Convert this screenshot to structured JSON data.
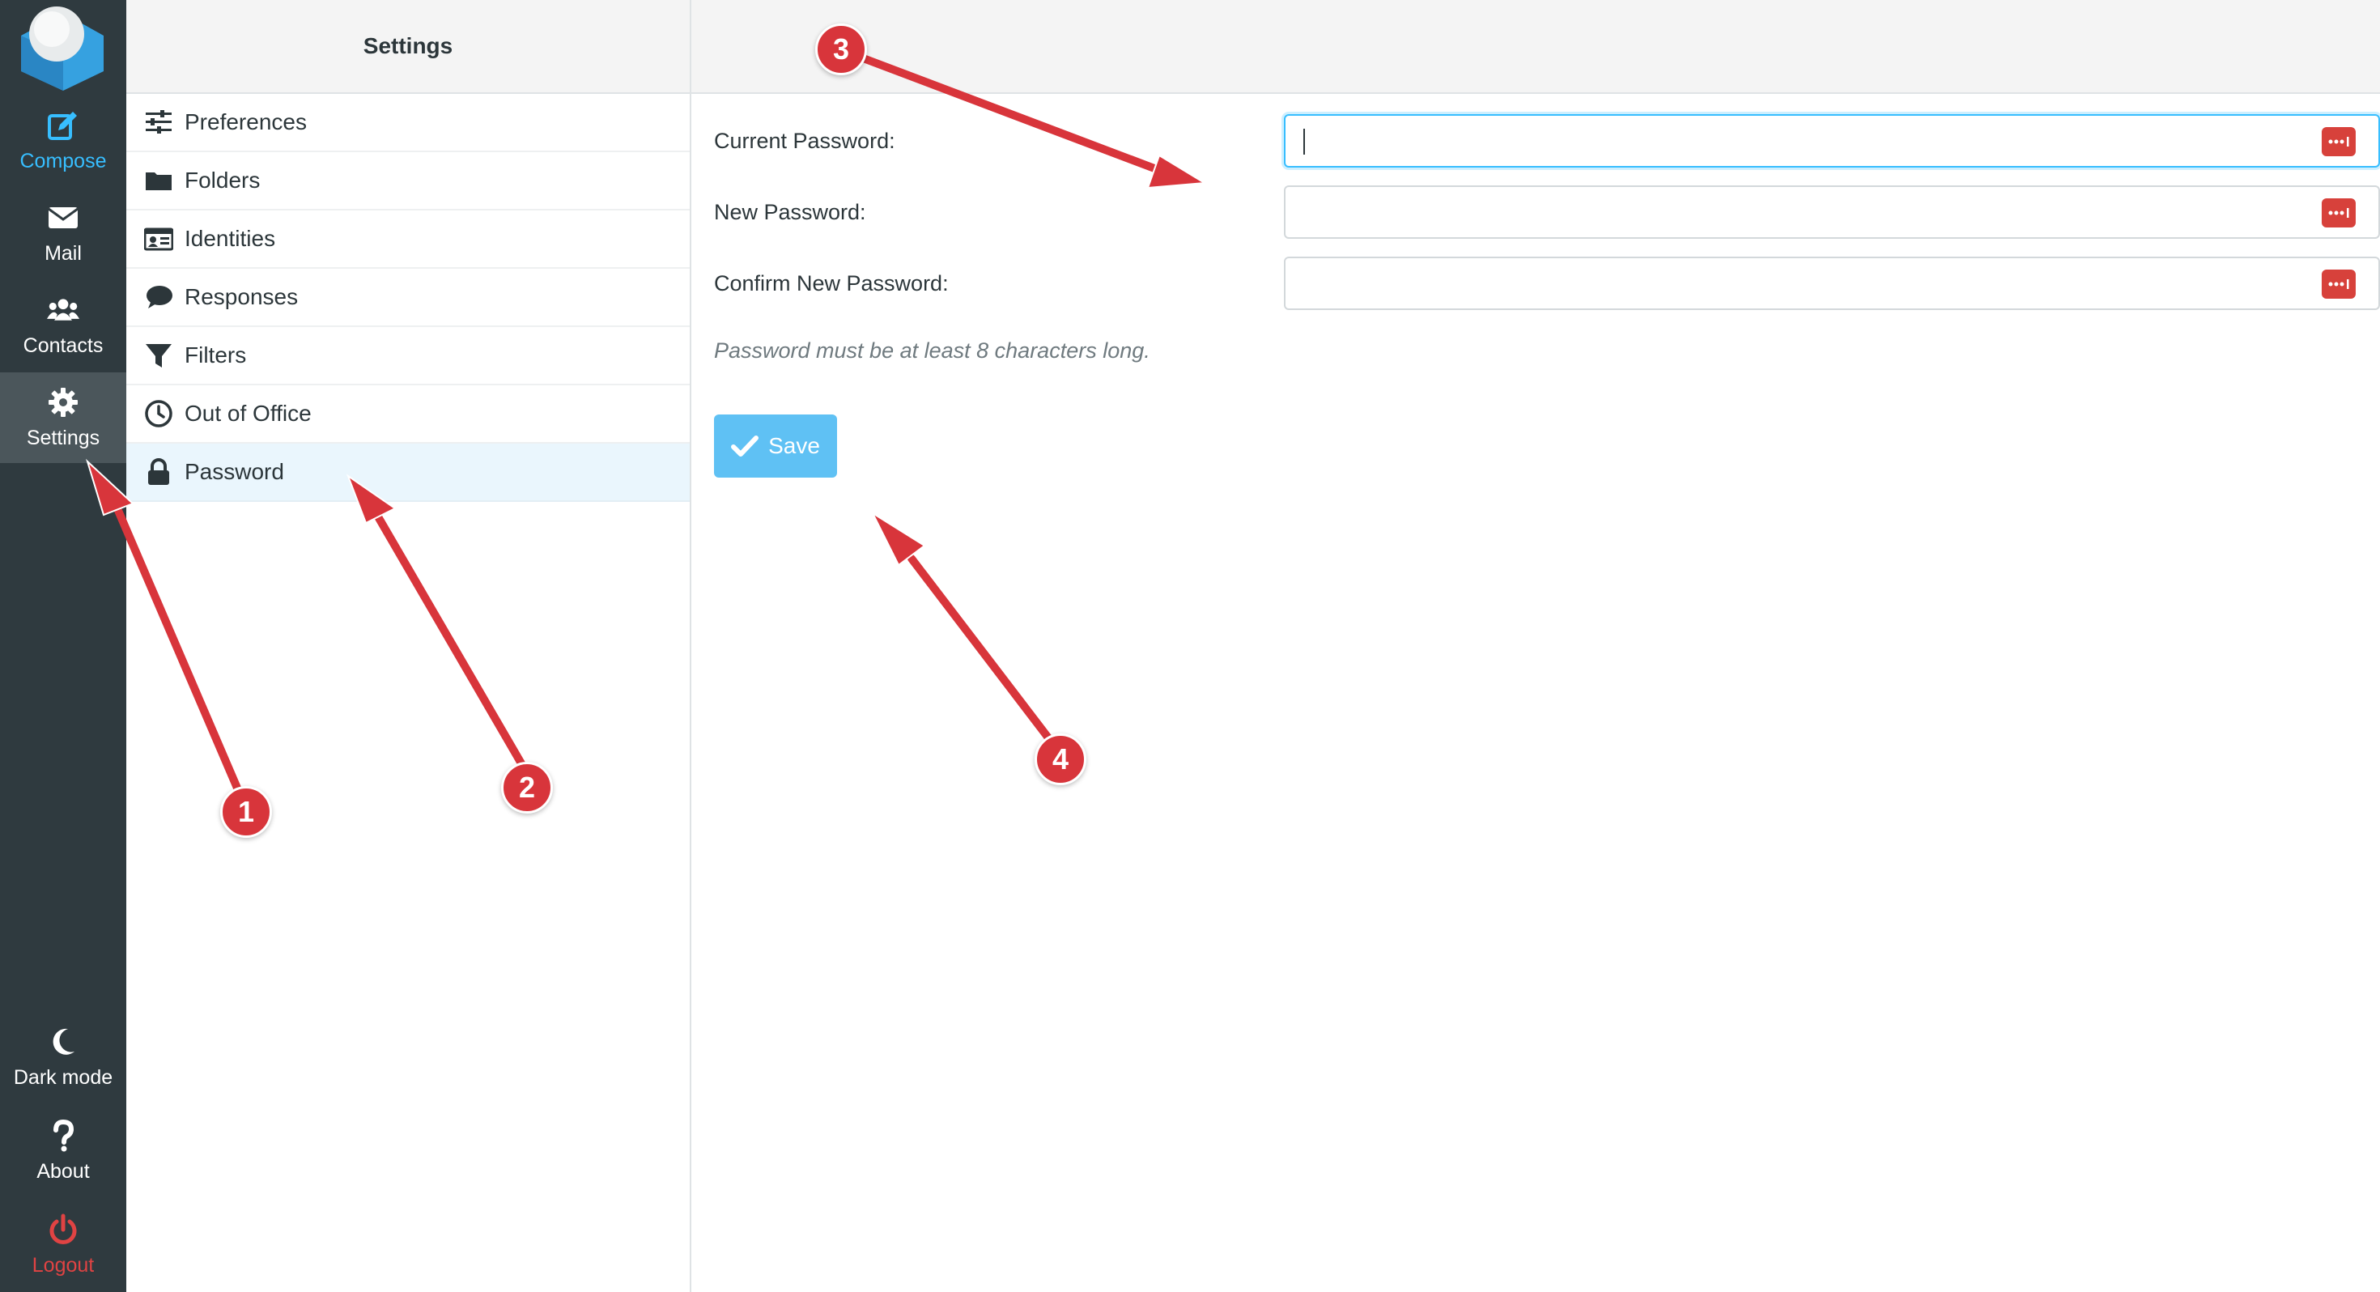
{
  "rail": {
    "items": [
      {
        "label": "Compose",
        "icon": "compose-icon"
      },
      {
        "label": "Mail",
        "icon": "mail-icon"
      },
      {
        "label": "Contacts",
        "icon": "contacts-icon"
      },
      {
        "label": "Settings",
        "icon": "gear-icon"
      }
    ],
    "bottom": [
      {
        "label": "Dark mode",
        "icon": "moon-icon"
      },
      {
        "label": "About",
        "icon": "question-icon"
      },
      {
        "label": "Logout",
        "icon": "power-icon"
      }
    ],
    "active": "Settings"
  },
  "settings_list": {
    "title": "Settings",
    "items": [
      {
        "label": "Preferences",
        "icon": "sliders-icon"
      },
      {
        "label": "Folders",
        "icon": "folder-icon"
      },
      {
        "label": "Identities",
        "icon": "id-card-icon"
      },
      {
        "label": "Responses",
        "icon": "comment-icon"
      },
      {
        "label": "Filters",
        "icon": "filter-icon"
      },
      {
        "label": "Out of Office",
        "icon": "clock-icon"
      },
      {
        "label": "Password",
        "icon": "lock-icon"
      }
    ],
    "selected": "Password"
  },
  "password_form": {
    "fields": [
      {
        "label": "Current Password:",
        "value": "",
        "focused": true
      },
      {
        "label": "New Password:",
        "value": ""
      },
      {
        "label": "Confirm New Password:",
        "value": ""
      }
    ],
    "hint": "Password must be at least 8 characters long.",
    "save_label": "Save"
  },
  "annotations": {
    "badges": [
      "1",
      "2",
      "3",
      "4"
    ]
  },
  "colors": {
    "rail_bg": "#2f3a3f",
    "accent": "#37beff",
    "save_button": "#5fc1f4",
    "logout": "#e04343",
    "annotation": "#d8353b",
    "selected_row": "#eaf6fd"
  }
}
